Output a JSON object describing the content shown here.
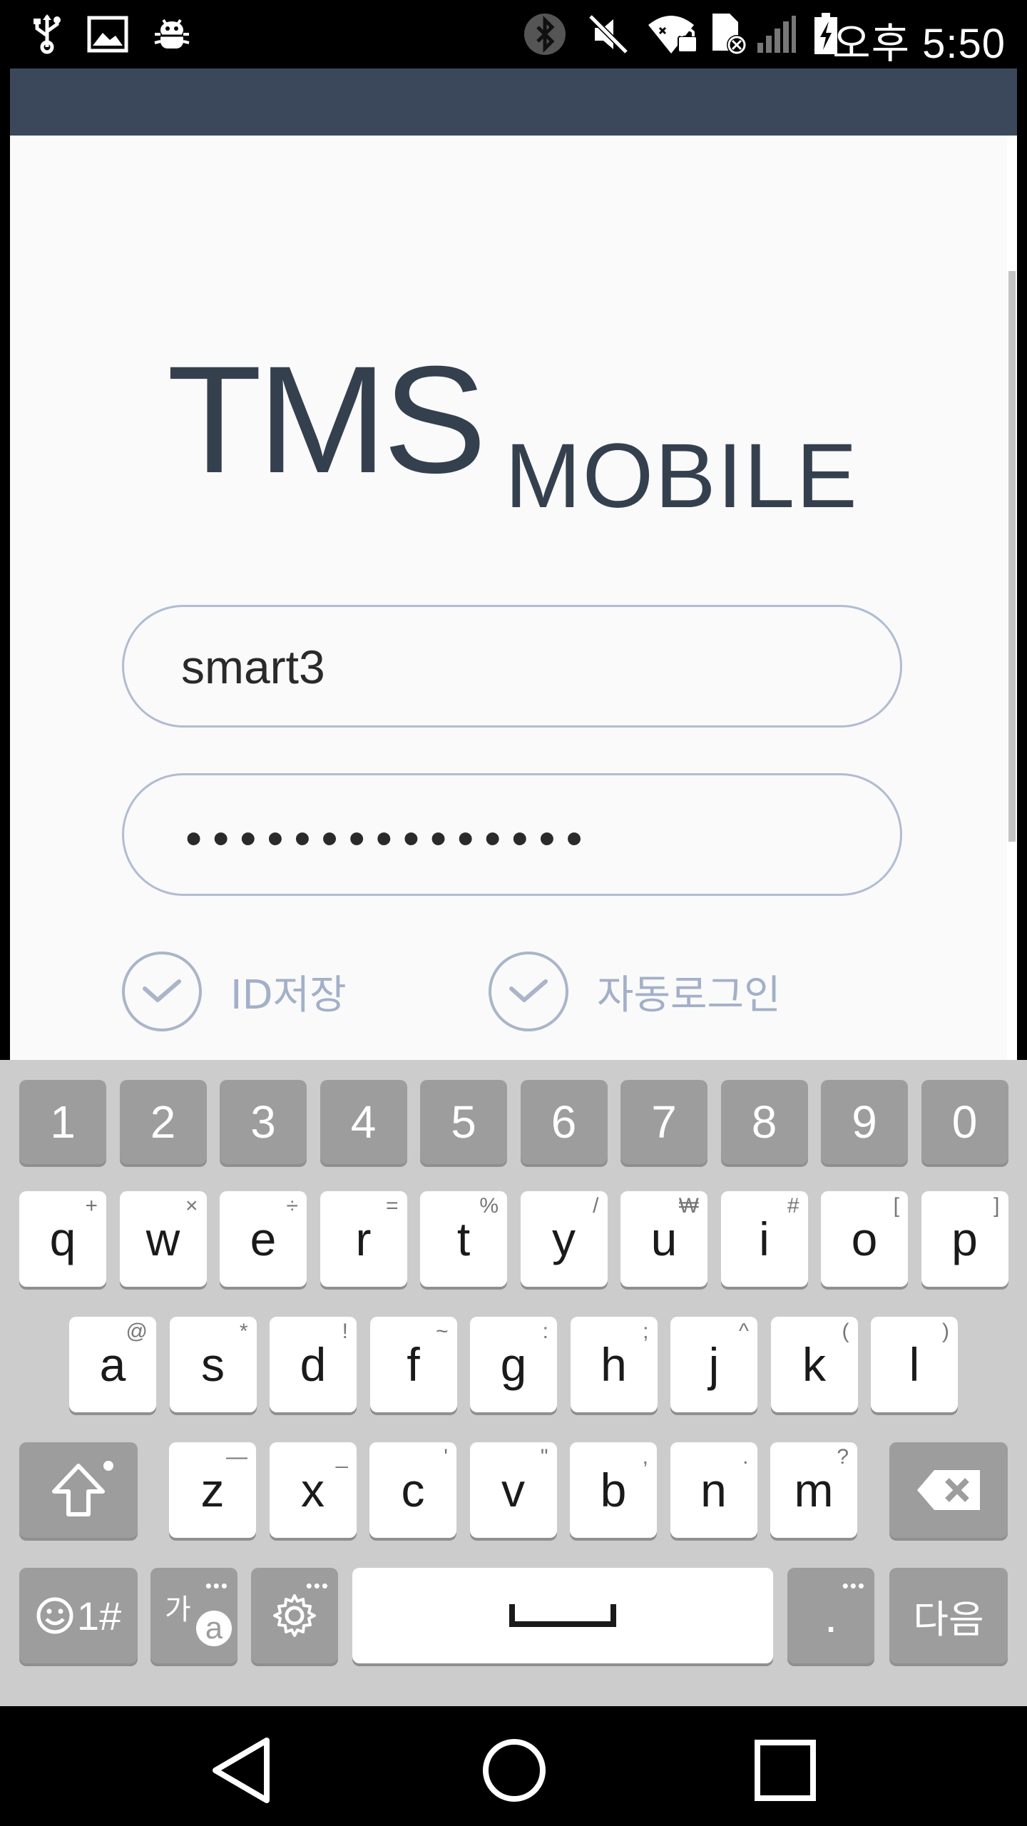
{
  "status_bar": {
    "time": "오후 5:50",
    "icons": [
      "usb-icon",
      "image-icon",
      "android-debug-icon",
      "bluetooth-icon",
      "mute-icon",
      "wifi-locked-icon",
      "sim-error-icon",
      "signal-icon",
      "battery-charging-icon"
    ]
  },
  "app": {
    "logo_main": "TMS",
    "logo_sub": "MOBILE",
    "id_field": {
      "value": "smart3"
    },
    "password_field": {
      "masked_value": "•••••••••••••••"
    },
    "save_id_label": "ID저장",
    "auto_login_label": "자동로그인"
  },
  "keyboard": {
    "number_row": [
      "1",
      "2",
      "3",
      "4",
      "5",
      "6",
      "7",
      "8",
      "9",
      "0"
    ],
    "row1": [
      {
        "key": "q",
        "sub": "+"
      },
      {
        "key": "w",
        "sub": "×"
      },
      {
        "key": "e",
        "sub": "÷"
      },
      {
        "key": "r",
        "sub": "="
      },
      {
        "key": "t",
        "sub": "%"
      },
      {
        "key": "y",
        "sub": "/"
      },
      {
        "key": "u",
        "sub": "₩"
      },
      {
        "key": "i",
        "sub": "#"
      },
      {
        "key": "o",
        "sub": "["
      },
      {
        "key": "p",
        "sub": "]"
      }
    ],
    "row2": [
      {
        "key": "a",
        "sub": "@"
      },
      {
        "key": "s",
        "sub": "*"
      },
      {
        "key": "d",
        "sub": "!"
      },
      {
        "key": "f",
        "sub": "~"
      },
      {
        "key": "g",
        "sub": ":"
      },
      {
        "key": "h",
        "sub": ";"
      },
      {
        "key": "j",
        "sub": "^"
      },
      {
        "key": "k",
        "sub": "("
      },
      {
        "key": "l",
        "sub": ")"
      }
    ],
    "row3": [
      {
        "key": "z",
        "sub": "—"
      },
      {
        "key": "x",
        "sub": "_"
      },
      {
        "key": "c",
        "sub": "'"
      },
      {
        "key": "v",
        "sub": "\""
      },
      {
        "key": "b",
        "sub": ","
      },
      {
        "key": "n",
        "sub": "."
      },
      {
        "key": "m",
        "sub": "?"
      }
    ],
    "symbols_label": "1#",
    "lang_label_top": "가",
    "lang_label_bottom": "a",
    "period_label": ".",
    "next_label": "다음"
  },
  "colors": {
    "header": "#3b475b",
    "logo": "#35404f",
    "field_border": "#b1bcd3",
    "check_label": "#a3b0c8",
    "keyboard_bg": "#cccccc",
    "key_gray": "#9d9d9d"
  }
}
